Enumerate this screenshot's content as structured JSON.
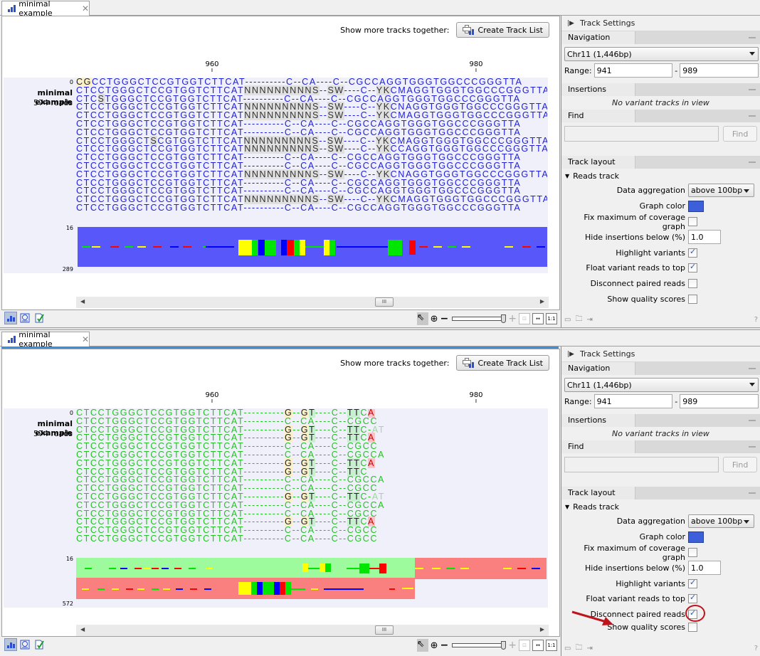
{
  "tab": {
    "title": "minimal example",
    "close_icon": "close-icon"
  },
  "toolbar": {
    "show_more_label": "Show more tracks together:",
    "create_track_list_label": "Create Track List"
  },
  "ruler": {
    "ticks": [
      "960",
      "980"
    ]
  },
  "track": {
    "name": "minimal example",
    "reads_count": "574 reads"
  },
  "panels": [
    {
      "axis_labels": {
        "top": "0",
        "coverage_top": "16",
        "coverage_bottom": "289"
      },
      "color_scheme": "blue",
      "coverage_fill": "#5757fa",
      "reads": [
        [
          [
            "y",
            "CG"
          ],
          [
            "",
            "CCTGGGCTCCGTGGTCTTCAT----------C--CA----C--CGCCAGGTGGGTGGCCCGGGTTA"
          ]
        ],
        [
          [
            "",
            "CTCCTGGGCTCCGTGGTCTTCAT"
          ],
          [
            "v",
            "NNNNNNNNNS"
          ],
          [
            "",
            "--"
          ],
          [
            "v",
            "SW"
          ],
          [
            "",
            "----C--"
          ],
          [
            "v",
            "YK"
          ],
          [
            "",
            "CMAGGTGGGTGGCCCGGGTTA"
          ]
        ],
        [
          [
            "",
            "CTC"
          ],
          [
            "v",
            "S"
          ],
          [
            "",
            "TGGGCTCCGTGGTCTTCAT----------C--CA----C--CGCCAGGTGGGTGGCCCGGGTTA"
          ]
        ],
        [
          [
            "",
            "CTCCTGGGCTCCGTGGTCTTCAT"
          ],
          [
            "v",
            "NNNNNNNNNS"
          ],
          [
            "",
            "--"
          ],
          [
            "v",
            "SW"
          ],
          [
            "",
            "----C--"
          ],
          [
            "v",
            "YK"
          ],
          [
            "",
            "CNAGGTGGGTGGCCCGGGTTA"
          ]
        ],
        [
          [
            "",
            "CTCCTGGGCTCCGTGGTCTTCAT"
          ],
          [
            "v",
            "NNNNNNNNNS"
          ],
          [
            "",
            "--"
          ],
          [
            "v",
            "SW"
          ],
          [
            "",
            "----C--"
          ],
          [
            "v",
            "YK"
          ],
          [
            "",
            "CMAGGTGGGTGGCCCGGGTTA"
          ]
        ],
        [
          [
            "",
            "CTCCTGGGCTCCGTGGTCTTCAT----------C--CA----C--CGCCAGGTGGGTGGCCCGGGTTA"
          ]
        ],
        [
          [
            "",
            "CTCCTGGGCTCCGTGGTCTTCAT----------C--CA----C--CGCCAGGTGGGTGGCCCGGGTTA"
          ]
        ],
        [
          [
            "",
            "CTCCTGGGCT"
          ],
          [
            "v",
            "S"
          ],
          [
            "",
            "CGTGGTCTTCAT"
          ],
          [
            "v",
            "NNNNNNNNNS"
          ],
          [
            "",
            "--"
          ],
          [
            "v",
            "SW"
          ],
          [
            "",
            "----C--"
          ],
          [
            "v",
            "YK"
          ],
          [
            "",
            "CMAGGTGGGTGGCCCGGGTTA"
          ]
        ],
        [
          [
            "",
            "CTCCTGGGCTCCGTGGTCTTCAT"
          ],
          [
            "v",
            "NNNNNNNNNS"
          ],
          [
            "",
            "--"
          ],
          [
            "v",
            "SW"
          ],
          [
            "",
            "----C--"
          ],
          [
            "v",
            "YK"
          ],
          [
            "",
            "CCAGGTGGGTGGCCCGGGTTA"
          ]
        ],
        [
          [
            "",
            "CTCCTGGGCTCCGTGGTCTTCAT----------C--CA----C--CGCCAGGTGGGTGGCCCGGGTTA"
          ]
        ],
        [
          [
            "",
            "CTCCTGGGCTCCGTGGTCTTCAT----------C--CA----C--CGCCAGGTGGGTGGCCCGGGTTA"
          ]
        ],
        [
          [
            "",
            "CTCCTGGGCTCCGTGGTCTTCAT"
          ],
          [
            "v",
            "NNNNNNNNNS"
          ],
          [
            "",
            "--"
          ],
          [
            "v",
            "SW"
          ],
          [
            "",
            "----C--"
          ],
          [
            "v",
            "YK"
          ],
          [
            "",
            "CNAGGTGGGTGGCCCGGGTTA"
          ]
        ],
        [
          [
            "",
            "CTCCTGGGCTCCGTGGTCTTCAT----------C--CA----C--CGCCAGGTGGGTGGCCCGGGTTA"
          ]
        ],
        [
          [
            "",
            "CTCCTGGGCTCCGTGGTCTTCAT----------C--CA----C--CGCCAGGTGGGTGGCCCGGGTTA"
          ]
        ],
        [
          [
            "",
            "CTCCTGGGCTCCGTGGTCTTCAT"
          ],
          [
            "v",
            "NNNNNNNNNS"
          ],
          [
            "",
            "--"
          ],
          [
            "v",
            "SW"
          ],
          [
            "",
            "----C--"
          ],
          [
            "v",
            "YK"
          ],
          [
            "",
            "CMAGGTGGGTGGCCCGGGTTA"
          ]
        ],
        [
          [
            "",
            "CTCCTGGGCTCCGTGGTCTTCAT----------C--CA----C--CGCCAGGTGGGTGGCCCGGGTTA"
          ]
        ]
      ]
    },
    {
      "axis_labels": {
        "top": "0",
        "coverage_top": "16",
        "coverage_bottom": "572"
      },
      "color_scheme": "green",
      "forward_fill": "#9dfa9d",
      "reverse_fill": "#fa7f7f",
      "reads": [
        [
          [
            "",
            "CTCCTGGGCTCCGTGGTCTTCAT----------"
          ],
          [
            "y",
            "G"
          ],
          [
            "",
            "--"
          ],
          [
            "y",
            "G"
          ],
          [
            "g",
            "T"
          ],
          [
            "",
            "----C--"
          ],
          [
            "g",
            "TT"
          ],
          [
            "",
            "C"
          ],
          [
            "r",
            "A"
          ]
        ],
        [
          [
            "",
            "CTCCTGGGCTCCGTGGTCTTCAT----------C--CA----C--CGCC"
          ]
        ],
        [
          [
            "",
            "CTCCTGGGCTCCGTGGTCTTCAT----------"
          ],
          [
            "y",
            "G"
          ],
          [
            "",
            "--"
          ],
          [
            "y",
            "G"
          ],
          [
            "g",
            "T"
          ],
          [
            "",
            "----C--"
          ],
          [
            "g",
            "TT"
          ],
          [
            "",
            "C-"
          ],
          [
            "f",
            "AT"
          ]
        ],
        [
          [
            "",
            "CTCCTGGGCTCCGTGGTCTTCAT----------"
          ],
          [
            "y",
            "G"
          ],
          [
            "",
            "--"
          ],
          [
            "y",
            "G"
          ],
          [
            "g",
            "T"
          ],
          [
            "",
            "----C--"
          ],
          [
            "g",
            "TT"
          ],
          [
            "",
            "C"
          ],
          [
            "r",
            "A"
          ]
        ],
        [
          [
            "",
            "CTCCTGGGCTCCGTGGTCTTCAT----------C--CA----C--CGCC"
          ]
        ],
        [
          [
            "",
            "CTCCTGGGCTCCGTGGTCTTCAT----------C--CA----C--CGCCA"
          ]
        ],
        [
          [
            "",
            "CTCCTGGGCTCCGTGGTCTTCAT----------"
          ],
          [
            "y",
            "G"
          ],
          [
            "",
            "--"
          ],
          [
            "y",
            "G"
          ],
          [
            "g",
            "T"
          ],
          [
            "",
            "----C--"
          ],
          [
            "g",
            "TT"
          ],
          [
            "",
            "C"
          ],
          [
            "r",
            "A"
          ]
        ],
        [
          [
            "",
            "CTCCTGGGCTCCGTGGTCTTCAT----------"
          ],
          [
            "y",
            "G"
          ],
          [
            "",
            "--"
          ],
          [
            "y",
            "G"
          ],
          [
            "g",
            "T"
          ],
          [
            "",
            "----C--"
          ],
          [
            "g",
            "TT"
          ],
          [
            "",
            "C"
          ]
        ],
        [
          [
            "",
            "CTCCTGGGCTCCGTGGTCTTCAT----------C--CA----C--CGCCA"
          ]
        ],
        [
          [
            "",
            "CTCCTGGGCTCCGTGGTCTTCAT----------C--CA----C--CGCC"
          ]
        ],
        [
          [
            "",
            "CTCCTGGGCTCCGTGGTCTTCAT----------"
          ],
          [
            "y",
            "G"
          ],
          [
            "",
            "--"
          ],
          [
            "y",
            "G"
          ],
          [
            "g",
            "T"
          ],
          [
            "",
            "----C--"
          ],
          [
            "g",
            "TT"
          ],
          [
            "",
            "C-"
          ],
          [
            "f",
            "AT"
          ]
        ],
        [
          [
            "",
            "CTCCTGGGCTCCGTGGTCTTCAT----------C--CA----C--CGCCA"
          ]
        ],
        [
          [
            "",
            "CTCCTGGGCTCCGTGGTCTTCAT----------C--CA----C--CGCC"
          ]
        ],
        [
          [
            "",
            "CTCCTGGGCTCCGTGGTCTTCAT----------"
          ],
          [
            "y",
            "G"
          ],
          [
            "",
            "--"
          ],
          [
            "y",
            "G"
          ],
          [
            "g",
            "T"
          ],
          [
            "",
            "----C--"
          ],
          [
            "g",
            "TT"
          ],
          [
            "",
            "C"
          ],
          [
            "r",
            "A"
          ]
        ],
        [
          [
            "",
            "CTCCTGGGCTCCGTGGTCTTCAT----------C--CA----C--CGCC"
          ]
        ],
        [
          [
            "",
            "CTCCTGGGCTCCGTGGTCTTCAT----------C--CA----C--CGCC"
          ]
        ]
      ]
    }
  ],
  "side_panel": {
    "title": "Track Settings",
    "navigation": {
      "label": "Navigation",
      "chromosome": "Chr11 (1,446bp)",
      "range_label": "Range:",
      "range_from": "941",
      "range_sep": "-",
      "range_to": "989"
    },
    "insertions": {
      "label": "Insertions",
      "message": "No variant tracks in view"
    },
    "find": {
      "label": "Find",
      "input_value": "",
      "button_label": "Find"
    },
    "track_layout": {
      "label": "Track layout",
      "reads_track_label": "Reads track",
      "data_aggregation_label": "Data aggregation",
      "data_aggregation_value": "above 100bp",
      "graph_color_label": "Graph color",
      "graph_color": "#3d5fd9",
      "fix_max_label": "Fix maximum of coverage graph",
      "hide_insertions_label": "Hide insertions below (%)",
      "hide_insertions_value": "1.0",
      "highlight_variants_label": "Highlight variants",
      "float_variant_label": "Float variant reads to top",
      "disconnect_label": "Disconnect paired reads",
      "show_quality_label": "Show quality scores"
    },
    "help_label": "?"
  },
  "states": [
    {
      "fix_max": false,
      "highlight_variants": true,
      "float_variant": true,
      "disconnect": false,
      "show_quality": false
    },
    {
      "fix_max": false,
      "highlight_variants": true,
      "float_variant": true,
      "disconnect": true,
      "show_quality": false
    }
  ],
  "zoom_slider": {
    "level": 0.95
  },
  "scrollbar": {
    "position": 0.65
  },
  "annotation": {
    "arrow_color": "#c0141c",
    "highlight_circle_target": "Disconnect paired reads"
  }
}
